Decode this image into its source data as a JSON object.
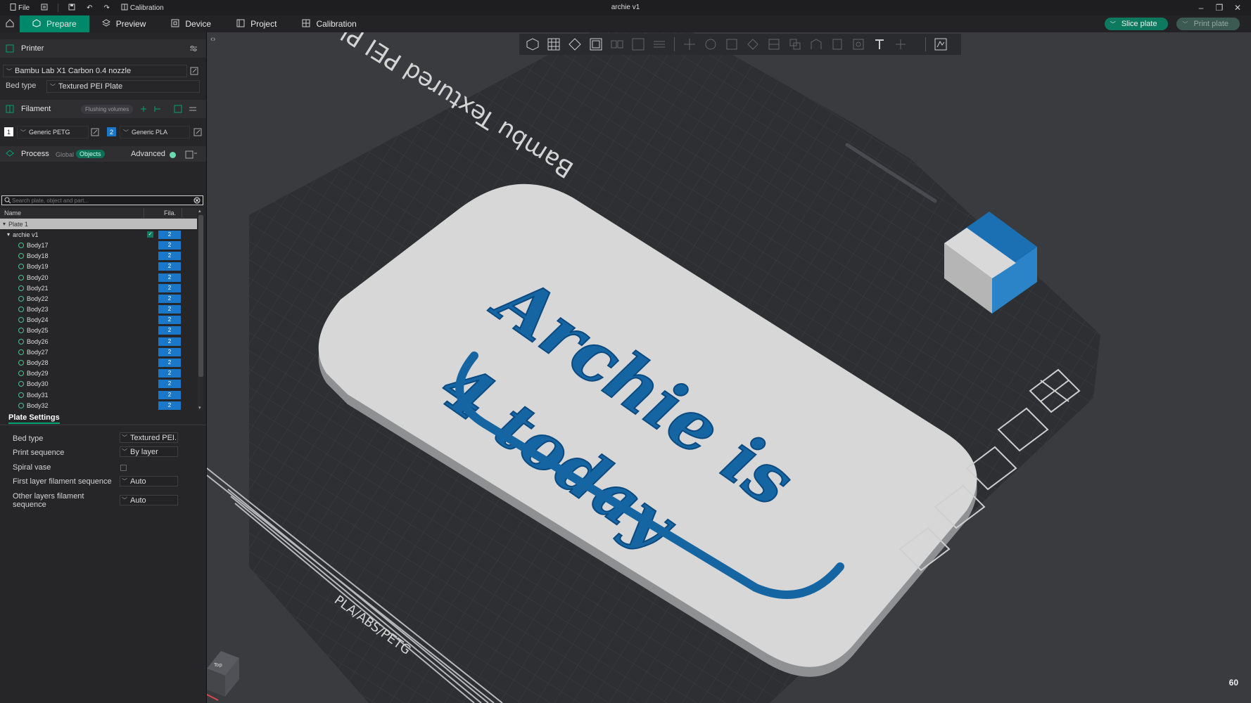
{
  "titlebar": {
    "file_label": "File",
    "calibration_label": "Calibration",
    "window_title": "archie v1"
  },
  "tabs": [
    {
      "label": "Prepare"
    },
    {
      "label": "Preview"
    },
    {
      "label": "Device"
    },
    {
      "label": "Project"
    },
    {
      "label": "Calibration"
    }
  ],
  "actions": {
    "slice_label": "Slice plate",
    "print_label": "Print plate"
  },
  "printer": {
    "section_title": "Printer",
    "printer_name": "Bambu Lab X1 Carbon 0.4 nozzle",
    "bed_type_label": "Bed type",
    "bed_type_value": "Textured PEI Plate"
  },
  "filament": {
    "section_title": "Filament",
    "flushing_label": "Flushing volumes",
    "slots": [
      {
        "index": "1",
        "name": "Generic PETG",
        "color": "#ffffff"
      },
      {
        "index": "2",
        "name": "Generic PLA",
        "color": "#1b78c8"
      }
    ]
  },
  "process": {
    "section_title": "Process",
    "global_label": "Global",
    "objects_label": "Objects",
    "advanced_label": "Advanced"
  },
  "search": {
    "placeholder": "Search plate, object and part..."
  },
  "object_tree": {
    "col_name": "Name",
    "col_fila": "Fila.",
    "plate_label": "Plate 1",
    "object_label": "archie v1",
    "object_fil": "2",
    "bodies": [
      {
        "name": "Body17",
        "fil": "2"
      },
      {
        "name": "Body18",
        "fil": "2"
      },
      {
        "name": "Body19",
        "fil": "2"
      },
      {
        "name": "Body20",
        "fil": "2"
      },
      {
        "name": "Body21",
        "fil": "2"
      },
      {
        "name": "Body22",
        "fil": "2"
      },
      {
        "name": "Body23",
        "fil": "2"
      },
      {
        "name": "Body24",
        "fil": "2"
      },
      {
        "name": "Body25",
        "fil": "2"
      },
      {
        "name": "Body26",
        "fil": "2"
      },
      {
        "name": "Body27",
        "fil": "2"
      },
      {
        "name": "Body28",
        "fil": "2"
      },
      {
        "name": "Body29",
        "fil": "2"
      },
      {
        "name": "Body30",
        "fil": "2"
      },
      {
        "name": "Body31",
        "fil": "2"
      },
      {
        "name": "Body32",
        "fil": "2"
      }
    ]
  },
  "plate_settings": {
    "tab_label": "Plate Settings",
    "rows": [
      {
        "label": "Bed type",
        "value": "Textured PEI..."
      },
      {
        "label": "Print sequence",
        "value": "By layer"
      },
      {
        "label": "Spiral vase",
        "value": ""
      },
      {
        "label": "First layer filament sequence",
        "value": "Auto"
      },
      {
        "label": "Other layers filament sequence",
        "value": "Auto"
      }
    ]
  },
  "scene": {
    "plate_label": "Bambu Textured PEI Plate",
    "plate_material": "PLA/ABS/PETG",
    "model_line1": "Archie is",
    "model_line2": "4 today",
    "axis_cube_label": "Top",
    "fps": "60",
    "colors": {
      "accent": "#00886a",
      "model_base": "#d7d7d7",
      "model_text": "#1565a3",
      "bed": "#2e2f33"
    }
  }
}
